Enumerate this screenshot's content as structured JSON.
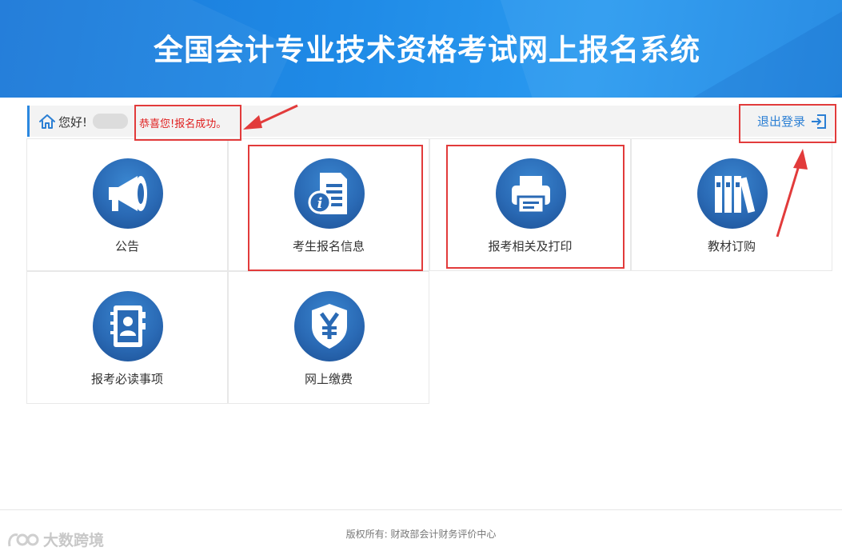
{
  "header": {
    "title": "全国会计专业技术资格考试网上报名系统"
  },
  "userbar": {
    "greeting": "您好!",
    "success_message": "恭喜您!报名成功。",
    "logout_label": "退出登录"
  },
  "tiles": [
    {
      "label": "公告",
      "icon": "megaphone-icon"
    },
    {
      "label": "考生报名信息",
      "icon": "info-document-icon"
    },
    {
      "label": "报考相关及打印",
      "icon": "printer-icon"
    },
    {
      "label": "教材订购",
      "icon": "books-icon"
    },
    {
      "label": "报考必读事项",
      "icon": "contact-book-icon"
    },
    {
      "label": "网上缴费",
      "icon": "yuan-shield-icon"
    }
  ],
  "footer": {
    "copyright": "版权所有: 财政部会计财务评价中心"
  },
  "watermark": {
    "text": "大数跨境"
  },
  "colors": {
    "header_blue": "#1f8ae6",
    "accent_blue": "#2b88e0",
    "icon_blue": "#2a6ab5",
    "success_red": "#e02020",
    "annotation_red": "#e23b3b"
  }
}
